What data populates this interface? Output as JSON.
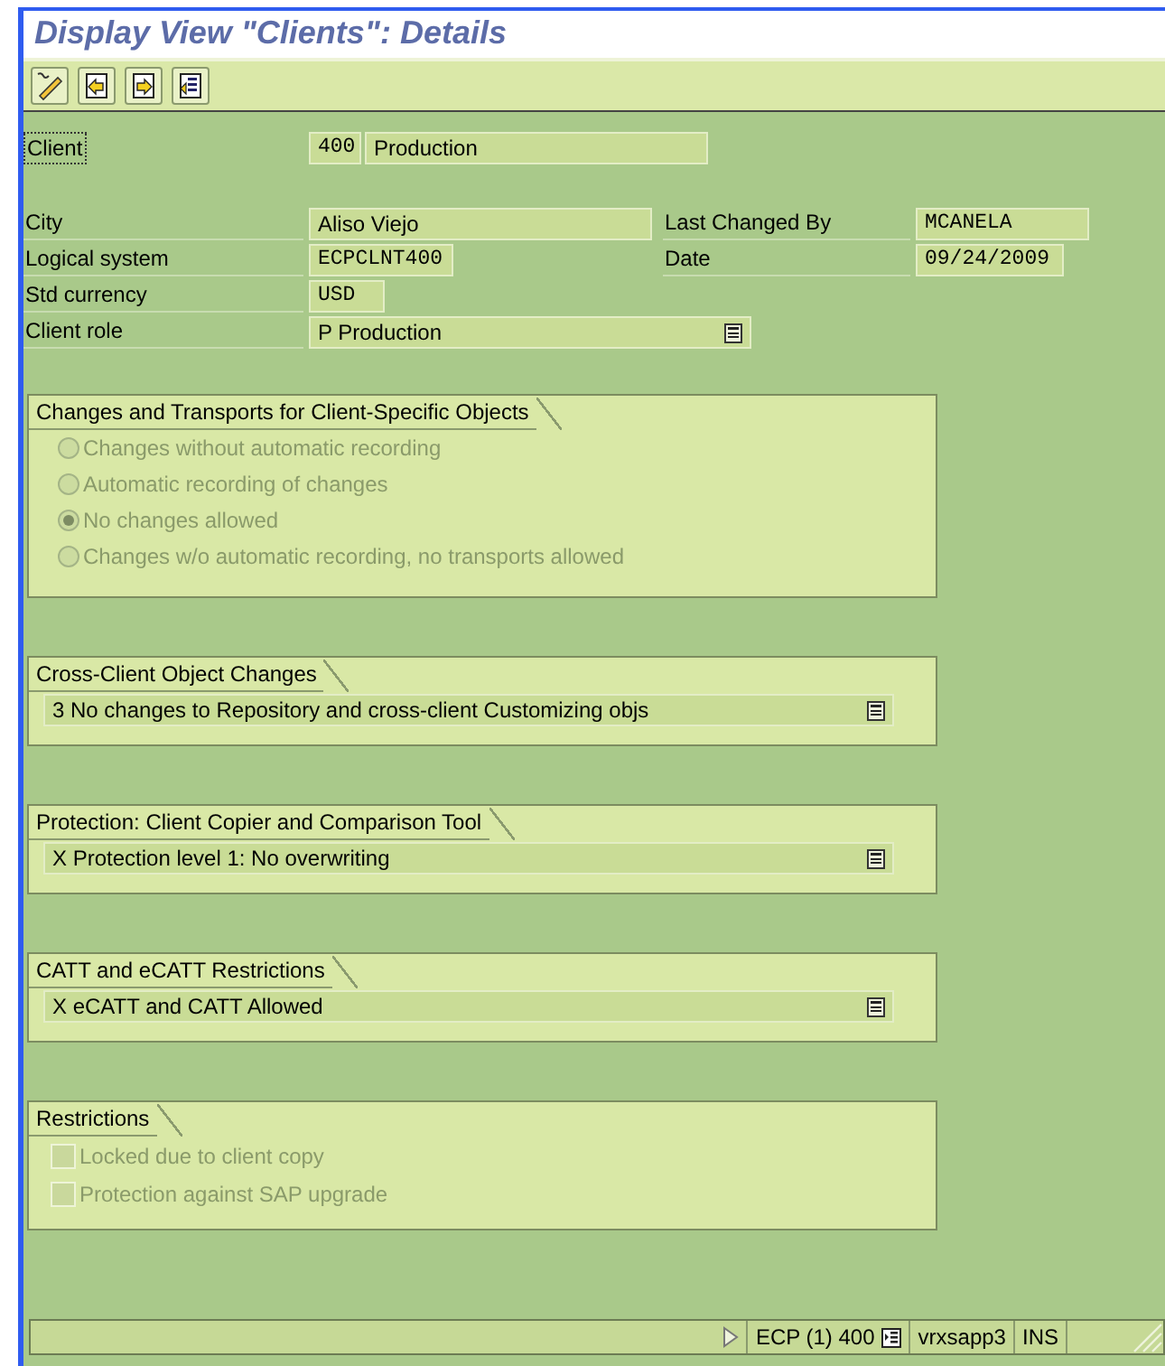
{
  "window": {
    "title": "Display View \"Clients\": Details"
  },
  "toolbar": [
    {
      "kind": "edit"
    },
    {
      "kind": "previous"
    },
    {
      "kind": "next"
    },
    {
      "kind": "list"
    }
  ],
  "client": {
    "label": "Client",
    "number": "400",
    "name": "Production"
  },
  "rows": [
    {
      "fields": [
        {
          "label": "City",
          "value": "Aliso Viejo",
          "kind": "text"
        },
        {
          "label": "Last Changed By",
          "value": "MCANELA",
          "kind": "code"
        }
      ]
    },
    {
      "fields": [
        {
          "label": "Logical system",
          "value": "ECPCLNT400",
          "kind": "code"
        },
        {
          "label": "Date",
          "value": "09/24/2009",
          "kind": "code"
        }
      ]
    },
    {
      "fields": [
        {
          "label": "Std currency",
          "value": "USD",
          "kind": "code"
        }
      ]
    },
    {
      "fields": [
        {
          "label": "Client role",
          "value": "P Production",
          "kind": "dropdown"
        }
      ]
    }
  ],
  "groups": [
    {
      "title": "Changes and Transports for Client-Specific Objects",
      "kind": "radios",
      "options": [
        {
          "label": "Changes without automatic recording",
          "selected": false,
          "disabled": true
        },
        {
          "label": "Automatic recording of changes",
          "selected": false,
          "disabled": true
        },
        {
          "label": "No changes allowed",
          "selected": true,
          "disabled": true
        },
        {
          "label": "Changes w/o automatic recording, no transports allowed",
          "selected": false,
          "disabled": true
        }
      ]
    },
    {
      "title": "Cross-Client Object Changes",
      "kind": "dropdown",
      "value": "3 No changes to Repository and cross-client Customizing objs"
    },
    {
      "title": "Protection: Client Copier and Comparison Tool",
      "kind": "dropdown",
      "value": "X Protection level 1: No overwriting"
    },
    {
      "title": "CATT and eCATT Restrictions",
      "kind": "dropdown",
      "value": "X eCATT and CATT Allowed"
    },
    {
      "title": "Restrictions",
      "kind": "checkboxes",
      "options": [
        {
          "label": "Locked due to client copy",
          "checked": false,
          "disabled": true
        },
        {
          "label": "Protection against SAP upgrade",
          "checked": false,
          "disabled": true
        }
      ]
    }
  ],
  "status_bar": {
    "session": "ECP (1) 400",
    "server": "vrxsapp3",
    "mode": "INS"
  }
}
